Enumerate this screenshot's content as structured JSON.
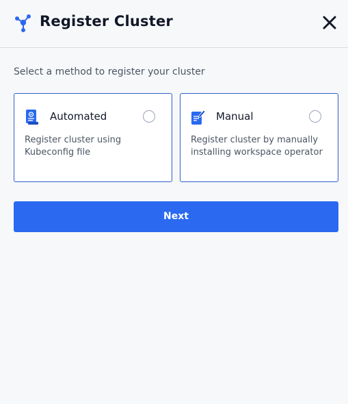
{
  "header": {
    "title": "Register Cluster",
    "logo_icon": "cluster-network-icon",
    "close_icon": "close-icon"
  },
  "subtitle": "Select a method to register your cluster",
  "options": [
    {
      "title": "Automated",
      "description": "Register cluster using Kubeconfig file",
      "icon": "kubeconfig-file-icon",
      "selected": false
    },
    {
      "title": "Manual",
      "description": "Register cluster by manually installing workspace operator",
      "icon": "manual-edit-document-icon",
      "selected": false
    }
  ],
  "next_label": "Next",
  "colors": {
    "accent": "#2a69f0",
    "card_border": "#2f5fce",
    "background": "#f7f8fa",
    "radio_border": "#9aa4b8"
  }
}
